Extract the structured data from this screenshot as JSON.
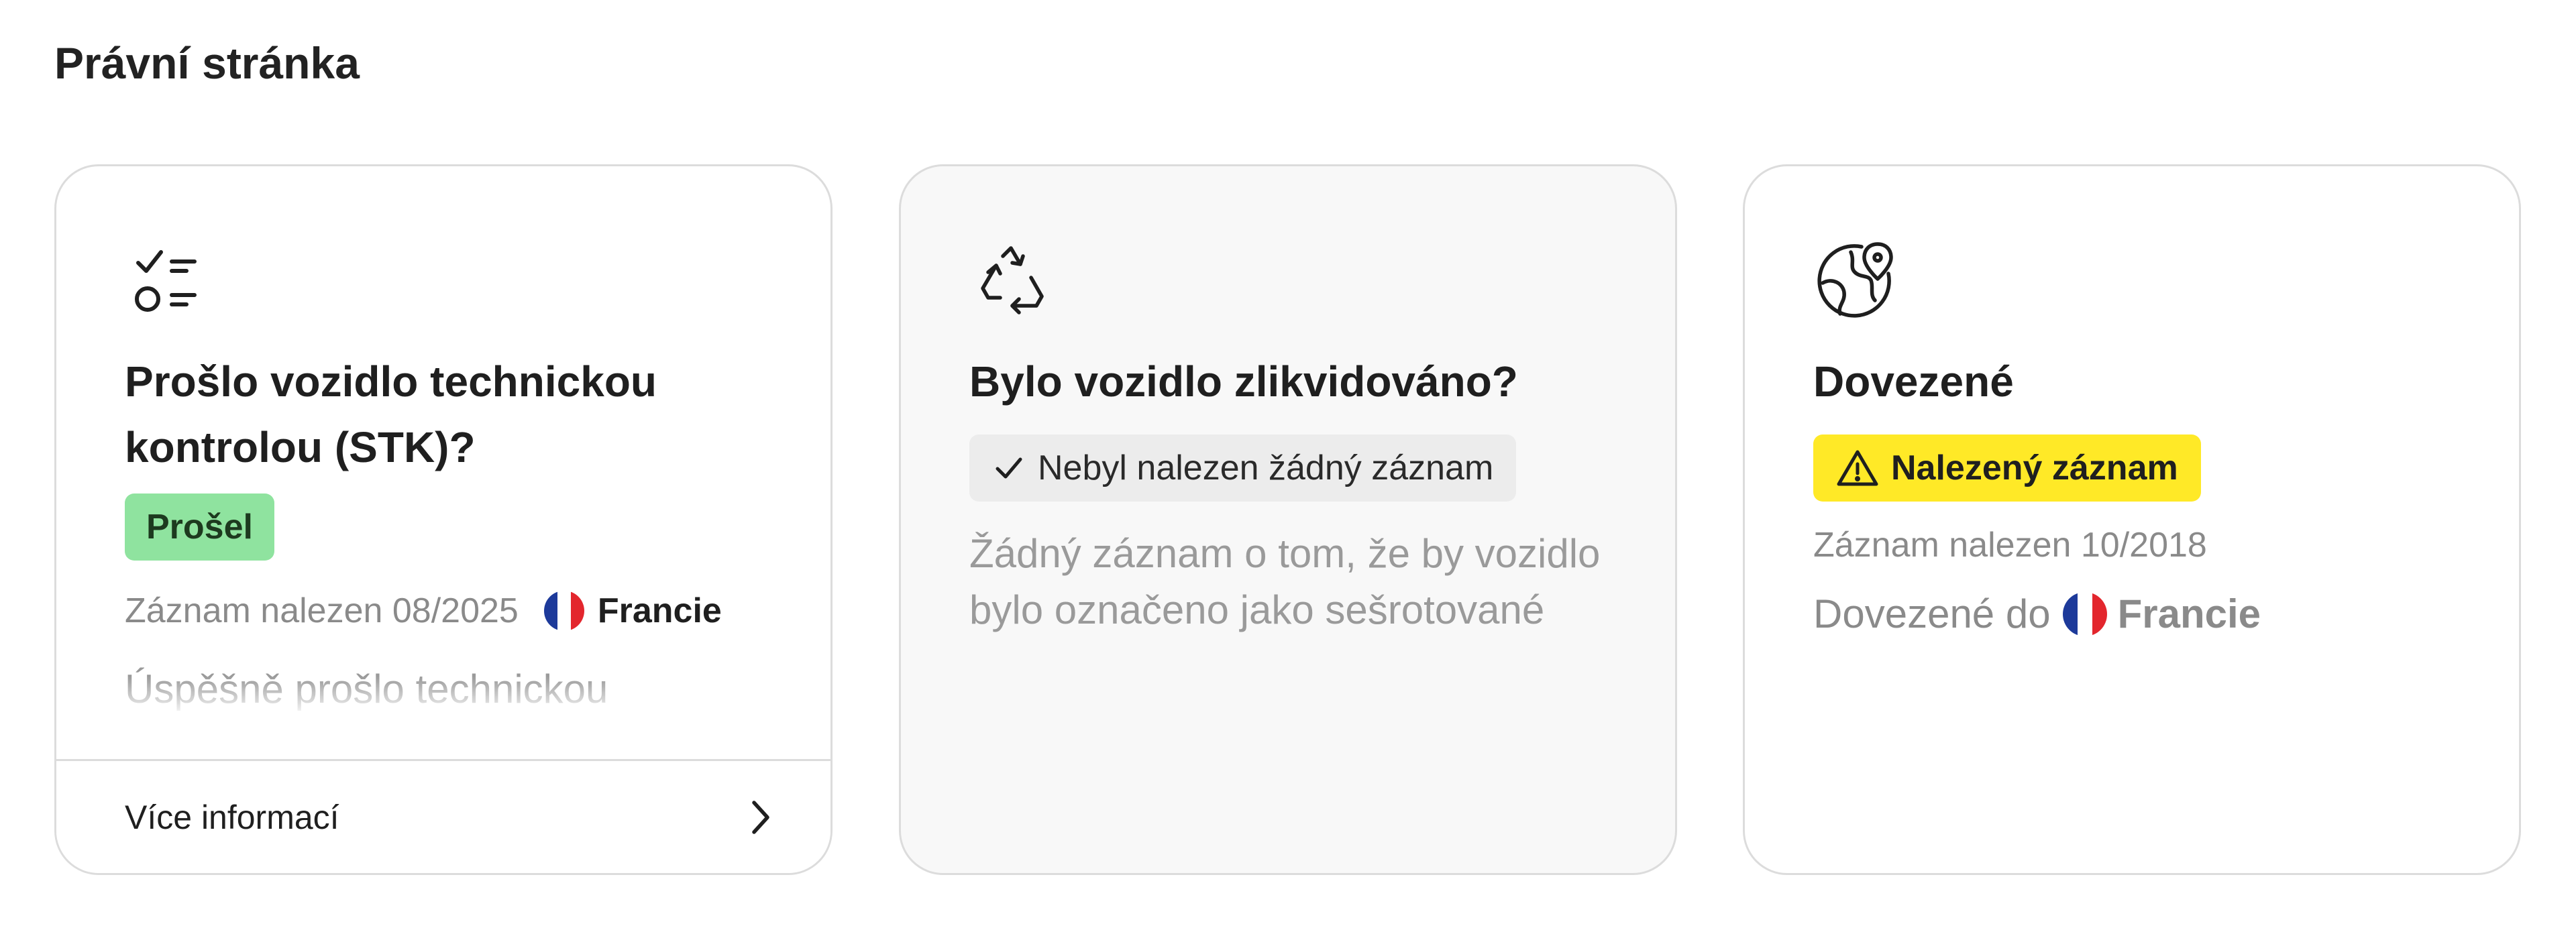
{
  "section": {
    "title": "Právní stránka"
  },
  "cards": [
    {
      "icon": "checklist-icon",
      "title": "Prošlo vozidlo technickou kontrolou (STK)?",
      "badge": "Prošel",
      "badge_color": "#8fe39f",
      "record_text": "Záznam nalezen 08/2025",
      "country": "Francie",
      "description": "Úspěšně prošlo technickou kontrolou",
      "more_label": "Více informací"
    },
    {
      "icon": "recycle-icon",
      "title": "Bylo vozidlo zlikvidováno?",
      "badge": "Nebyl nalezen žádný záznam",
      "badge_color": "#ececec",
      "description": "Žádný záznam o tom, že by vozidlo bylo označeno jako sešrotované"
    },
    {
      "icon": "globe-pin-icon",
      "title": "Dovezené",
      "badge": "Nalezený záznam",
      "badge_color": "#ffe927",
      "record_text": "Záznam nalezen 10/2018",
      "imported_to_label": "Dovezené do",
      "country": "Francie"
    }
  ]
}
